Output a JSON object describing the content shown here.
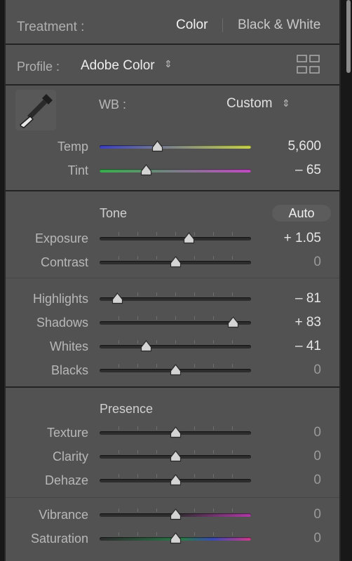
{
  "treatment": {
    "label": "Treatment :",
    "options": [
      "Color",
      "Black & White"
    ],
    "selected": "Color"
  },
  "profile": {
    "label": "Profile :",
    "value": "Adobe Color",
    "browse_icon": "grid-icon"
  },
  "wb": {
    "eyedropper_icon": "eyedropper-icon",
    "label": "WB :",
    "value": "Custom",
    "sliders": [
      {
        "label": "Temp",
        "value": "5,600",
        "position": 0.38
      },
      {
        "label": "Tint",
        "value": "– 65",
        "position": 0.31
      }
    ]
  },
  "tone": {
    "title": "Tone",
    "auto_label": "Auto",
    "sliders": [
      {
        "label": "Exposure",
        "value": "+ 1.05",
        "position": 0.59
      },
      {
        "label": "Contrast",
        "value": "0",
        "position": 0.5
      },
      {
        "label": "Highlights",
        "value": "– 81",
        "position": 0.12
      },
      {
        "label": "Shadows",
        "value": "+ 83",
        "position": 0.88
      },
      {
        "label": "Whites",
        "value": "– 41",
        "position": 0.31
      },
      {
        "label": "Blacks",
        "value": "0",
        "position": 0.5
      }
    ]
  },
  "presence": {
    "title": "Presence",
    "sliders": [
      {
        "label": "Texture",
        "value": "0",
        "position": 0.5
      },
      {
        "label": "Clarity",
        "value": "0",
        "position": 0.5
      },
      {
        "label": "Dehaze",
        "value": "0",
        "position": 0.5
      },
      {
        "label": "Vibrance",
        "value": "0",
        "position": 0.5
      },
      {
        "label": "Saturation",
        "value": "0",
        "position": 0.5
      }
    ]
  },
  "colors": {
    "panel_bg": "#525252",
    "temp_gradient": [
      "#3b3fbf",
      "#c8d24a"
    ],
    "tint_gradient": [
      "#36b04c",
      "#c24ac4"
    ],
    "vibrance_gradient": [
      "#2d2d2d",
      "#2d2d2d",
      "#b03aa8"
    ],
    "saturation_gradient": [
      "#2d2d2d",
      "#2d2d2d",
      "#d03a8a"
    ]
  }
}
